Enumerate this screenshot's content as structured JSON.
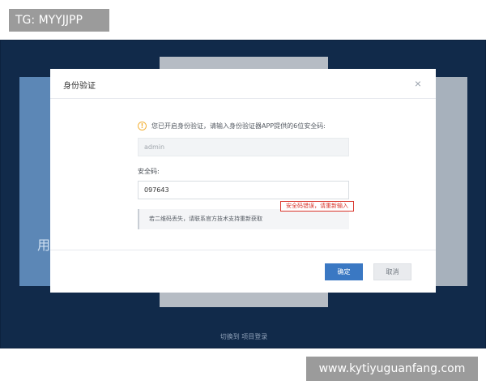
{
  "watermark": {
    "tg_label": "TG: MYYJJPP",
    "site_url": "www.kytiyuguanfang.com"
  },
  "background": {
    "card_text": "用",
    "switch_link": "切换到 项目登录"
  },
  "modal": {
    "title": "身份验证",
    "close_glyph": "×",
    "notice_icon_glyph": "!",
    "notice_text": "您已开启身份验证，请输入身份验证器APP提供的6位安全码:",
    "account_value": "admin",
    "code_label": "安全码:",
    "code_value": "097643",
    "error_text": "安全码错误，请重新输入",
    "lost_text": "若二维码丢失，请联系官方技术支持重新获取",
    "confirm_label": "确定",
    "cancel_label": "取消"
  },
  "icons": {
    "close": "close-icon",
    "notice": "info-warning-icon"
  },
  "colors": {
    "primary": "#3a78c3",
    "error": "#d9342b",
    "warning": "#f3b23a",
    "backdrop": "#112a4a"
  }
}
